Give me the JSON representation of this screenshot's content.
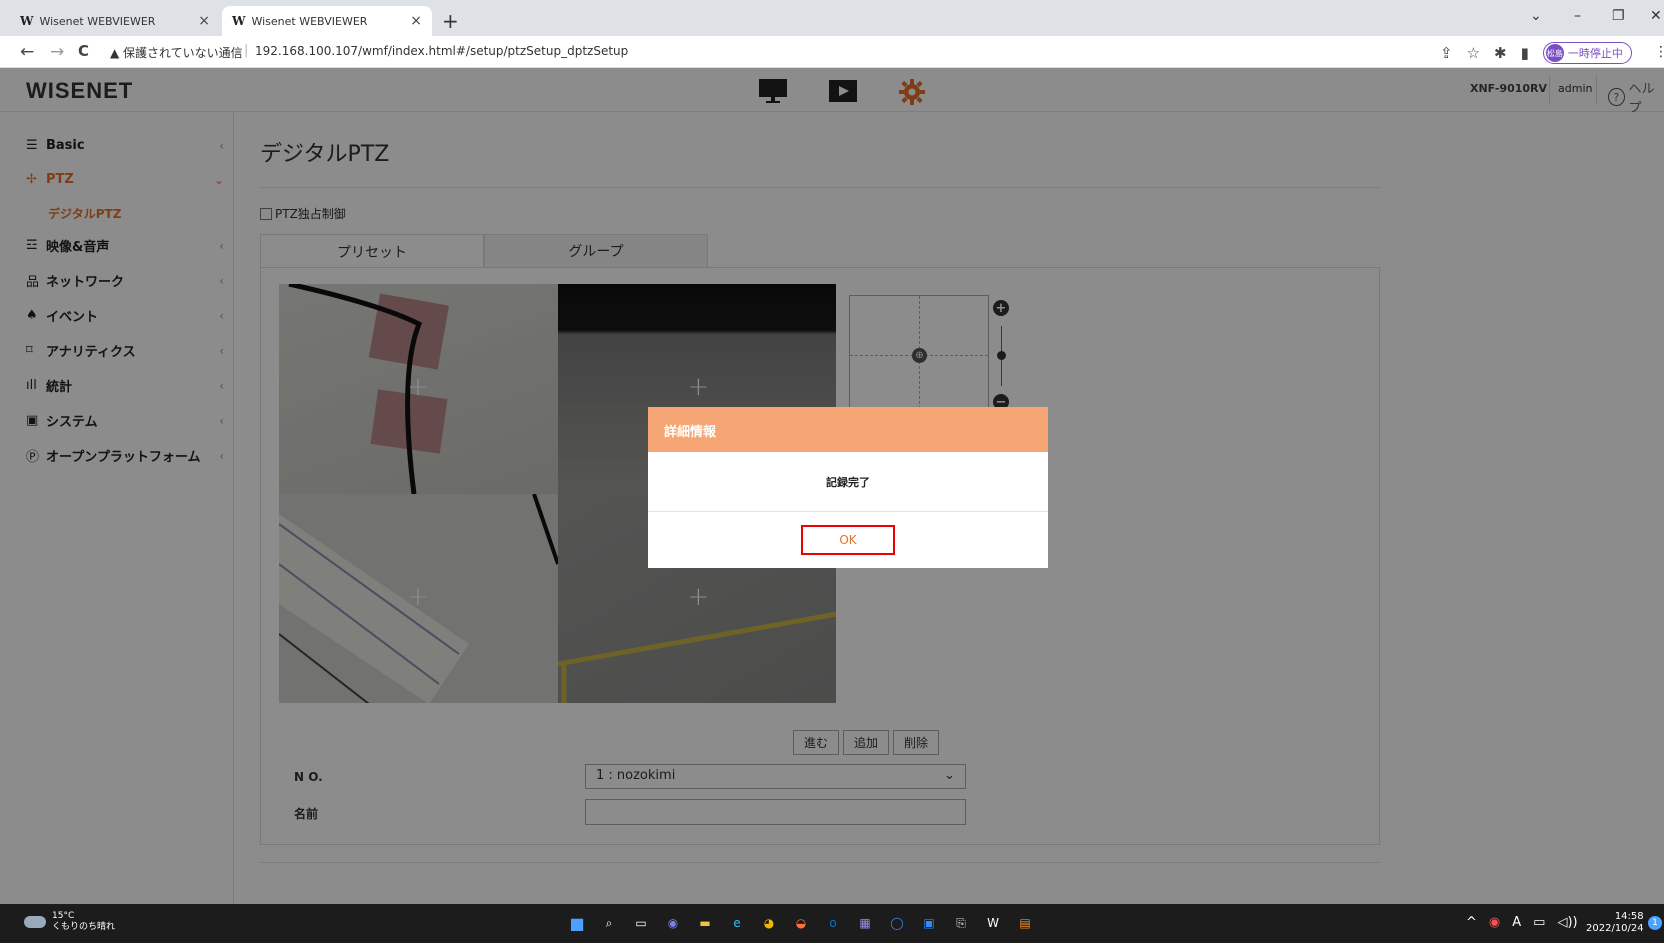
{
  "browser": {
    "tabs": [
      {
        "favicon": "W",
        "title": "Wisenet WEBVIEWER",
        "close": "×"
      },
      {
        "favicon": "W",
        "title": "Wisenet WEBVIEWER",
        "close": "×"
      }
    ],
    "new_tab": "+",
    "window_controls": {
      "dropdown": "⌄",
      "minimize": "–",
      "restore": "❐",
      "close": "✕"
    },
    "nav": {
      "back": "←",
      "forward": "→",
      "reload": "C"
    },
    "security_warning": "▲ 保護されていない通信",
    "url": "192.168.100.107/wmf/index.html#/setup/ptzSetup_dptzSetup",
    "profile_badge": "松島",
    "paused_label": "一時停止中",
    "menu": "⋮"
  },
  "header": {
    "logo": "WISENET",
    "model": "XNF-9010RV",
    "user": "admin",
    "help_icon": "?",
    "help_label": "ヘルプ"
  },
  "sidebar": {
    "items": [
      {
        "icon": "☰",
        "label": "Basic",
        "chevron": "‹"
      },
      {
        "icon": "✢",
        "label": "PTZ",
        "chevron": "⌄"
      },
      {
        "icon": "☲",
        "label": "映像&音声",
        "chevron": "‹"
      },
      {
        "icon": "品",
        "label": "ネットワーク",
        "chevron": "‹"
      },
      {
        "icon": "♠",
        "label": "イベント",
        "chevron": "‹"
      },
      {
        "icon": "⌑",
        "label": "アナリティクス",
        "chevron": "‹"
      },
      {
        "icon": "ıll",
        "label": "統計",
        "chevron": "‹"
      },
      {
        "icon": "▣",
        "label": "システム",
        "chevron": "‹"
      },
      {
        "icon": "Ⓟ",
        "label": "オープンプラットフォーム",
        "chevron": "‹"
      }
    ],
    "sub_item": "デジタルPTZ"
  },
  "main": {
    "title": "デジタルPTZ",
    "exclusive_checkbox": "PTZ独占制御",
    "tabs": [
      "プリセット",
      "グループ"
    ],
    "video_plus": "+",
    "ptz_center": "⊕",
    "zoom_in": "+",
    "zoom_out": "−",
    "buttons": {
      "go": "進む",
      "add": "追加",
      "delete": "削除"
    },
    "no_label": "N O.",
    "no_value": "1 : nozokimi",
    "no_chevron": "⌄",
    "name_label": "名前",
    "name_value": ""
  },
  "dialog": {
    "title": "詳細情報",
    "message": "記録完了",
    "ok_label": "OK"
  },
  "taskbar": {
    "temperature": "15°C",
    "weather": "くもりのち晴れ",
    "apps": [
      "■",
      "⌕",
      "▭",
      "◉",
      "▬",
      "e",
      "◕",
      "◒",
      "o",
      "▦",
      "◯",
      "▣",
      "⎘",
      "W",
      "▤"
    ],
    "tray": [
      "^",
      "◉",
      "A",
      "▭",
      "◁))"
    ],
    "time": "14:58",
    "date": "2022/10/24",
    "notification_count": "1"
  },
  "colors": {
    "accent": "#e8702a",
    "dialog_header": "#f5a674",
    "highlight_border": "#ee0000"
  }
}
